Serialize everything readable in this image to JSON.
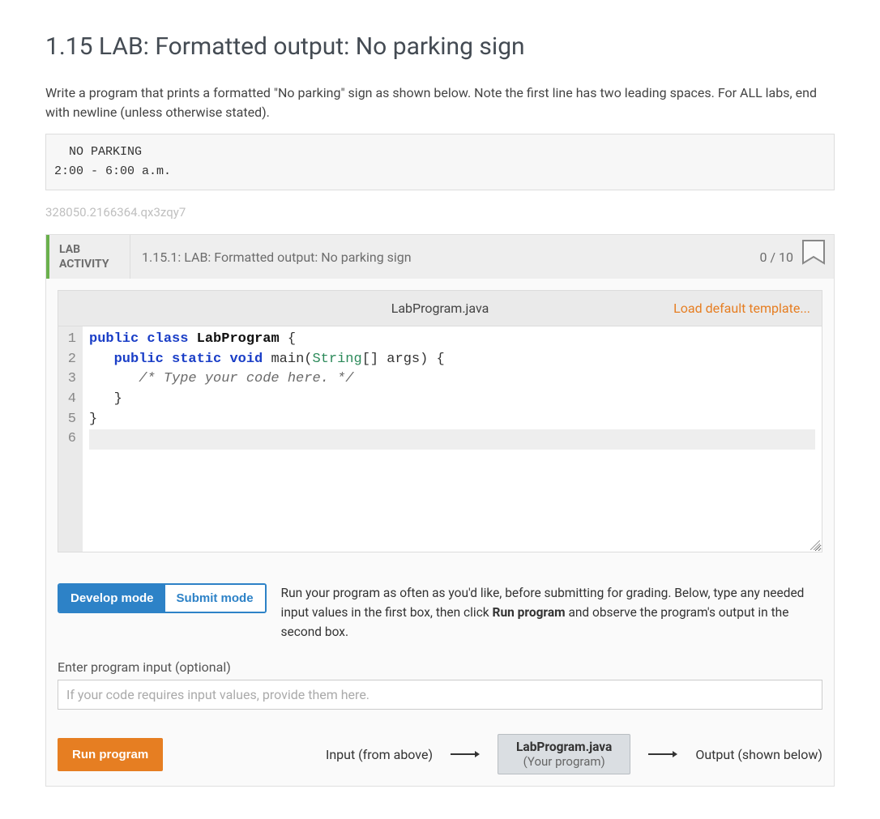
{
  "page": {
    "title": "1.15 LAB: Formatted output: No parking sign",
    "instructions": "Write a program that prints a formatted \"No parking\" sign as shown below. Note the first line has two leading spaces. For ALL labs, end with newline (unless otherwise stated).",
    "sample_output": "  NO PARKING\n2:00 - 6:00 a.m.",
    "activity_id": "328050.2166364.qx3zqy7"
  },
  "lab": {
    "label_line1": "LAB",
    "label_line2": "ACTIVITY",
    "title": "1.15.1: LAB: Formatted output: No parking sign",
    "score": "0 / 10"
  },
  "editor": {
    "filename": "LabProgram.java",
    "load_link": "Load default template...",
    "line_numbers": [
      "1",
      "2",
      "3",
      "4",
      "5",
      "6"
    ],
    "code": {
      "l1_kw1": "public",
      "l1_kw2": "class",
      "l1_class": "LabProgram",
      "l1_brace": " {",
      "l2_indent": "   ",
      "l2_kw1": "public",
      "l2_kw2": "static",
      "l2_kw3": "void",
      "l2_main": " main(",
      "l2_type": "String",
      "l2_params": "[] args) {",
      "l3_text": "      /* Type your code here. */",
      "l4_text": "   }",
      "l5_text": "}",
      "l6_text": ""
    }
  },
  "modes": {
    "develop": "Develop mode",
    "submit": "Submit mode",
    "description_pre": "Run your program as often as you'd like, before submitting for grading. Below, type any needed input values in the first box, then click ",
    "description_bold": "Run program",
    "description_post": " and observe the program's output in the second box."
  },
  "input": {
    "label": "Enter program input (optional)",
    "placeholder": "If your code requires input values, provide them here."
  },
  "run": {
    "button": "Run program",
    "input_label": "Input (from above)",
    "program_name": "LabProgram.java",
    "program_sub": "(Your program)",
    "output_label": "Output (shown below)"
  }
}
